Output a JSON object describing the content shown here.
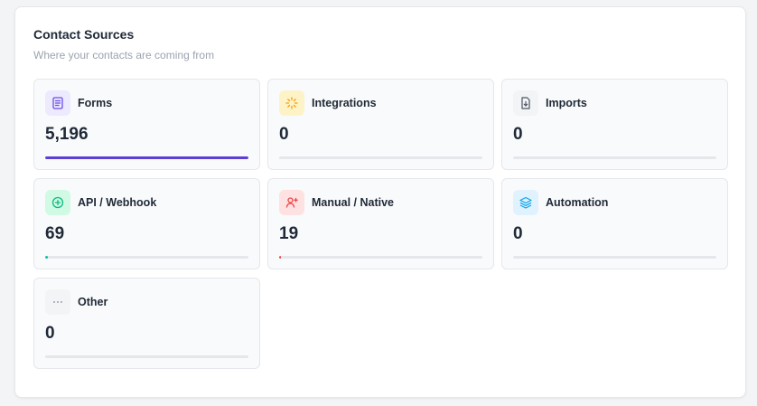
{
  "header": {
    "title": "Contact Sources",
    "subtitle": "Where your contacts are coming from"
  },
  "sources": [
    {
      "label": "Forms",
      "value": "5,196",
      "progress": 1.0,
      "icon": "document-icon",
      "icon_bg": "#ede9fe",
      "icon_color": "#6d4ee8",
      "bar_color": "#5b3fd6"
    },
    {
      "label": "Integrations",
      "value": "0",
      "progress": 0,
      "icon": "loader-icon",
      "icon_bg": "#fef3c7",
      "icon_color": "#f59e0b",
      "bar_color": "#f59e0b"
    },
    {
      "label": "Imports",
      "value": "0",
      "progress": 0,
      "icon": "file-import-icon",
      "icon_bg": "#f3f4f6",
      "icon_color": "#4b5563",
      "bar_color": "#6b7280"
    },
    {
      "label": "API / Webhook",
      "value": "69",
      "progress": 0.013,
      "icon": "plus-circle-icon",
      "icon_bg": "#d1fae5",
      "icon_color": "#10b981",
      "bar_color": "#14b8a6"
    },
    {
      "label": "Manual / Native",
      "value": "19",
      "progress": 0.004,
      "icon": "user-plus-icon",
      "icon_bg": "#fee2e2",
      "icon_color": "#ef4444",
      "bar_color": "#ef4444"
    },
    {
      "label": "Automation",
      "value": "0",
      "progress": 0,
      "icon": "layers-icon",
      "icon_bg": "#e0f2fe",
      "icon_color": "#0ea5e9",
      "bar_color": "#0ea5e9"
    },
    {
      "label": "Other",
      "value": "0",
      "progress": 0,
      "icon": "more-horizontal-icon",
      "icon_bg": "#f3f4f6",
      "icon_color": "#9ca3af",
      "bar_color": "#9ca3af"
    }
  ]
}
